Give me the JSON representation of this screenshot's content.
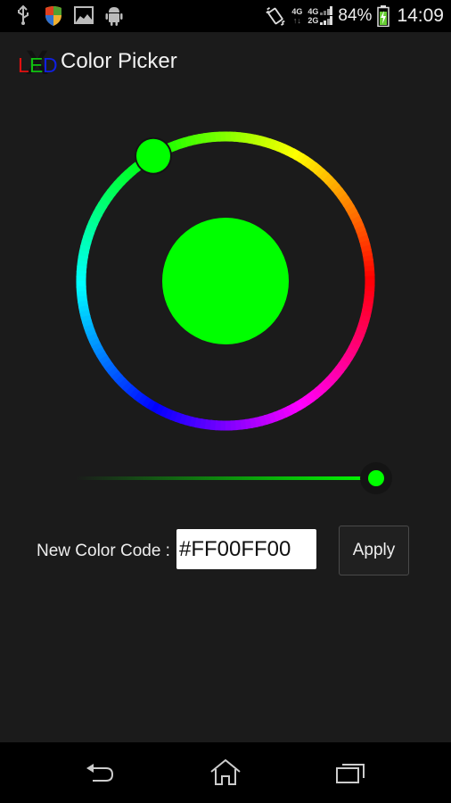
{
  "status_bar": {
    "left_icons": [
      "usb-icon",
      "shield-icon",
      "image-icon",
      "android-icon"
    ],
    "right_icons": [
      "vibrate-icon",
      "network-4g-icon",
      "signal-icon",
      "battery-charging-icon"
    ],
    "network_primary": "4G",
    "network_secondary_top": "4G",
    "network_secondary_bottom": "2G",
    "battery_percent": "84%",
    "time": "14:09"
  },
  "app_bar": {
    "logo_letters": [
      "L",
      "E",
      "D"
    ],
    "logo_colors": [
      "#e01010",
      "#10c010",
      "#1020e0"
    ],
    "logo_overlay": "X",
    "title": "Color Picker"
  },
  "color_picker": {
    "selected_hue_degrees": 120,
    "selected_color": "#00FF00",
    "brightness": 1.0
  },
  "color_code": {
    "label": "New Color Code :",
    "value": "#FF00FF00",
    "apply_label": "Apply"
  },
  "nav_bar": {
    "buttons": [
      "back-icon",
      "home-icon",
      "recents-icon"
    ]
  }
}
